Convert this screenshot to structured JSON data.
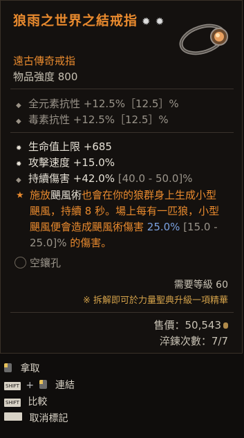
{
  "item": {
    "name": "狼雨之世界之結戒指",
    "stars": "✹ ✹",
    "type": "遠古傳奇戒指",
    "power": "物品強度 800"
  },
  "implicit": [
    {
      "bullet": "◆",
      "text": "全元素抗性 +12.5%［12.5］%"
    },
    {
      "bullet": "◆",
      "text": "毒素抗性 +12.5%［12.5］%"
    }
  ],
  "affixes": [
    {
      "bullet": "✹",
      "main": "生命值上限 +685",
      "range": ""
    },
    {
      "bullet": "✹",
      "main": "攻擊速度 +15.0%",
      "range": ""
    },
    {
      "bullet": "◆",
      "main": "持續傷害 +42.0%",
      "range": " [40.0 - 50.0]%"
    }
  ],
  "legendary": {
    "bullet": "★",
    "part1": "施放",
    "skill": "颶風術",
    "part2": "也會在你的狼群身上生成小型颶風，持續 8 秒。場上每有一匹狼，小型颶風便會造成颶風術傷害 ",
    "value": "25.0%",
    "range": " [15.0 - 25.0]%",
    "part3": " 的傷害。"
  },
  "socket": "空鑲孔",
  "requirement": "需要等級 60",
  "salvage": "※ 拆解即可於力量聖典升級一項精華",
  "price": "售價：50,543",
  "temper": "淬鍊次數：7/7",
  "controls": [
    {
      "label": "拿取",
      "key": ""
    },
    {
      "label": "連結",
      "key": "SHIFT"
    },
    {
      "label": "比較",
      "key": "SHIFT"
    },
    {
      "label": "取消標記",
      "key": ""
    }
  ],
  "colors": {
    "legendary": "#e98a2e",
    "blue_value": "#7aa1e0",
    "background": "#14110f"
  }
}
